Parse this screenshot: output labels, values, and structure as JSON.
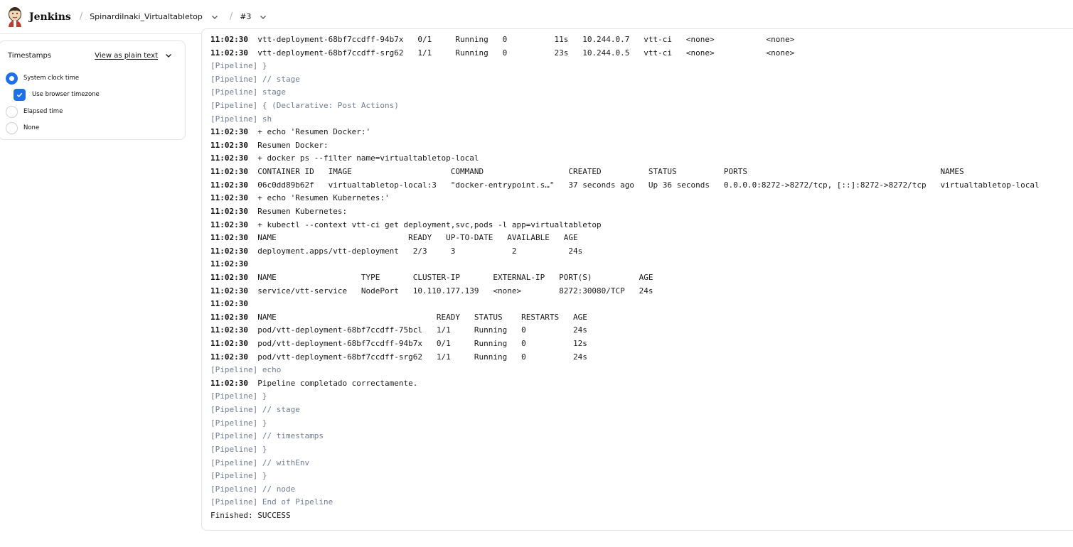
{
  "header": {
    "brand": "Jenkins",
    "separator": "/",
    "job": "Spinardilnaki_Virtualtabletop",
    "build": "#3"
  },
  "timestamps_panel": {
    "title": "Timestamps",
    "view_plain_text": "View as plain text",
    "options": [
      {
        "label": "System clock time",
        "selected": true
      },
      {
        "label": "Use browser timezone",
        "checked": true
      },
      {
        "label": "Elapsed time",
        "selected": false
      },
      {
        "label": "None",
        "selected": false
      }
    ]
  },
  "colors": {
    "accent": "#1f6feb",
    "pipeline_text": "#6e7e93"
  },
  "console": [
    {
      "ts": "11:02:30",
      "text": "vtt-deployment-68bf7ccdff-94b7x   0/1     Running   0          11s   10.244.0.7   vtt-ci   <none>           <none>"
    },
    {
      "ts": "11:02:30",
      "text": "vtt-deployment-68bf7ccdff-srg62   1/1     Running   0          23s   10.244.0.5   vtt-ci   <none>           <none>"
    },
    {
      "pipeline": true,
      "text": "[Pipeline] }"
    },
    {
      "pipeline": true,
      "text": "[Pipeline] // stage"
    },
    {
      "pipeline": true,
      "text": "[Pipeline] stage"
    },
    {
      "pipeline": true,
      "text": "[Pipeline] { (Declarative: Post Actions)"
    },
    {
      "pipeline": true,
      "text": "[Pipeline] sh"
    },
    {
      "ts": "11:02:30",
      "text": "+ echo 'Resumen Docker:'"
    },
    {
      "ts": "11:02:30",
      "text": "Resumen Docker:"
    },
    {
      "ts": "11:02:30",
      "text": "+ docker ps --filter name=virtualtabletop-local"
    },
    {
      "ts": "11:02:30",
      "text": "CONTAINER ID   IMAGE                     COMMAND                  CREATED          STATUS          PORTS                                         NAMES"
    },
    {
      "ts": "11:02:30",
      "text": "06c0dd89b62f   virtualtabletop-local:3   \"docker-entrypoint.s…\"   37 seconds ago   Up 36 seconds   0.0.0.0:8272->8272/tcp, [::]:8272->8272/tcp   virtualtabletop-local"
    },
    {
      "ts": "11:02:30",
      "text": "+ echo 'Resumen Kubernetes:'"
    },
    {
      "ts": "11:02:30",
      "text": "Resumen Kubernetes:"
    },
    {
      "ts": "11:02:30",
      "text": "+ kubectl --context vtt-ci get deployment,svc,pods -l app=virtualtabletop"
    },
    {
      "ts": "11:02:30",
      "text": "NAME                            READY   UP-TO-DATE   AVAILABLE   AGE"
    },
    {
      "ts": "11:02:30",
      "text": "deployment.apps/vtt-deployment   2/3     3            2           24s"
    },
    {
      "ts": "11:02:30",
      "text": ""
    },
    {
      "ts": "11:02:30",
      "text": "NAME                  TYPE       CLUSTER-IP       EXTERNAL-IP   PORT(S)          AGE"
    },
    {
      "ts": "11:02:30",
      "text": "service/vtt-service   NodePort   10.110.177.139   <none>        8272:30080/TCP   24s"
    },
    {
      "ts": "11:02:30",
      "text": ""
    },
    {
      "ts": "11:02:30",
      "text": "NAME                                  READY   STATUS    RESTARTS   AGE"
    },
    {
      "ts": "11:02:30",
      "text": "pod/vtt-deployment-68bf7ccdff-75bcl   1/1     Running   0          24s"
    },
    {
      "ts": "11:02:30",
      "text": "pod/vtt-deployment-68bf7ccdff-94b7x   0/1     Running   0          12s"
    },
    {
      "ts": "11:02:30",
      "text": "pod/vtt-deployment-68bf7ccdff-srg62   1/1     Running   0          24s"
    },
    {
      "pipeline": true,
      "text": "[Pipeline] echo"
    },
    {
      "ts": "11:02:30",
      "text": "Pipeline completado correctamente."
    },
    {
      "pipeline": true,
      "text": "[Pipeline] }"
    },
    {
      "pipeline": true,
      "text": "[Pipeline] // stage"
    },
    {
      "pipeline": true,
      "text": "[Pipeline] }"
    },
    {
      "pipeline": true,
      "text": "[Pipeline] // timestamps"
    },
    {
      "pipeline": true,
      "text": "[Pipeline] }"
    },
    {
      "pipeline": true,
      "text": "[Pipeline] // withEnv"
    },
    {
      "pipeline": true,
      "text": "[Pipeline] }"
    },
    {
      "pipeline": true,
      "text": "[Pipeline] // node"
    },
    {
      "pipeline": true,
      "text": "[Pipeline] End of Pipeline"
    },
    {
      "text": "Finished: SUCCESS"
    }
  ]
}
